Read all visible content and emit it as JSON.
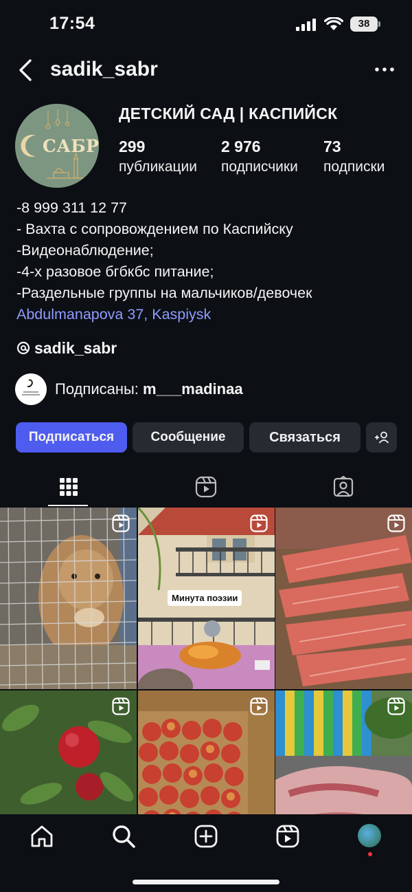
{
  "status_bar": {
    "time": "17:54",
    "battery": "38"
  },
  "header": {
    "username": "sadik_sabr",
    "more_label": "•••"
  },
  "profile": {
    "name": "ДЕТСКИЙ САД | КАСПИЙСК",
    "avatar_text": "САБР",
    "stats": [
      {
        "value": "299",
        "label": "публикации"
      },
      {
        "value": "2 976",
        "label": "подписчики"
      },
      {
        "value": "73",
        "label": "подписки"
      }
    ],
    "bio_lines": [
      "-8 999 311 12 77",
      "- Вахта с сопровождением по Каспийску",
      "-Видеонаблюдение;",
      "-4-х разовое бгбкбс питание;",
      "-Раздельные группы на мальчиков/девочек"
    ],
    "location": "Abdulmanapova 37, Kaspiysk",
    "threads_handle": "sadik_sabr",
    "followed_by_prefix": "Подписаны: ",
    "followed_by_user": "m___madinaa"
  },
  "buttons": {
    "follow": "Подписаться",
    "message": "Сообщение",
    "contact": "Связаться",
    "add_user": "+person"
  },
  "tabs": [
    {
      "name": "grid",
      "icon": "grid-icon",
      "active": true
    },
    {
      "name": "reels",
      "icon": "reels-icon",
      "active": false
    },
    {
      "name": "tagged",
      "icon": "tagged-icon",
      "active": false
    }
  ],
  "grid": {
    "poetry_caption": "Минута поэзии"
  },
  "colors": {
    "accent": "#4f5cf0",
    "link": "#8f9cff",
    "background": "#0c0f14"
  },
  "bottom_nav": [
    "home-icon",
    "search-icon",
    "create-icon",
    "reels-icon",
    "profile-avatar"
  ]
}
